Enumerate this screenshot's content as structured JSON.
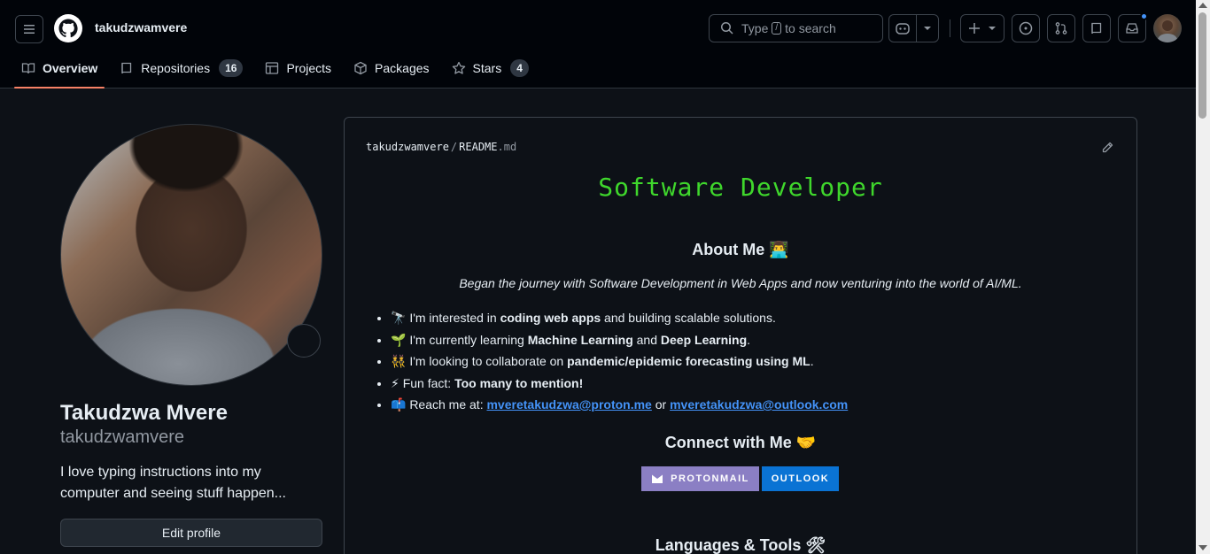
{
  "header": {
    "owner": "takudzwamvere",
    "search": {
      "prefix": "Type",
      "key": "/",
      "suffix": "to search"
    }
  },
  "tabs": [
    {
      "label": "Overview",
      "icon": "book-icon"
    },
    {
      "label": "Repositories",
      "icon": "repo-icon",
      "count": "16"
    },
    {
      "label": "Projects",
      "icon": "table-icon"
    },
    {
      "label": "Packages",
      "icon": "package-icon"
    },
    {
      "label": "Stars",
      "icon": "star-icon",
      "count": "4"
    }
  ],
  "profile": {
    "name": "Takudzwa Mvere",
    "login": "takudzwamvere",
    "bio": "I love typing instructions into my computer and seeing stuff happen...",
    "edit_label": "Edit profile"
  },
  "readme": {
    "path_owner": "takudzwamvere",
    "path_sep": "/",
    "path_file": "README",
    "path_ext": ".md",
    "title": "Software Developer",
    "about_heading": "About Me 👨‍💻",
    "journey": "Began the journey with Software Development in Web Apps and now venturing into the world of AI/ML.",
    "bullets": [
      {
        "pre": "🔭 I'm interested in ",
        "bold": "coding web apps",
        "post": " and building scalable solutions."
      },
      {
        "pre": "🌱 I'm currently learning ",
        "bold": "Machine Learning",
        "mid": " and ",
        "bold2": "Deep Learning",
        "post": "."
      },
      {
        "pre": "👯 I'm looking to collaborate on ",
        "bold": "pandemic/epidemic forecasting using ML",
        "post": "."
      },
      {
        "pre": "⚡ Fun fact: ",
        "bold": "Too many to mention!",
        "post": ""
      }
    ],
    "reach": {
      "pre": "📫 Reach me at: ",
      "email1": "mveretakudzwa@proton.me",
      "mid": " or ",
      "email2": "mveretakudzwa@outlook.com"
    },
    "connect_heading": "Connect with Me 🤝",
    "badges": {
      "proton": "PROTONMAIL",
      "outlook": "OUTLOOK"
    },
    "langs_heading": "Languages & Tools 🛠"
  },
  "colors": {
    "accent": "#f78166",
    "title_green": "#3fd72c",
    "link": "#4493f8"
  }
}
